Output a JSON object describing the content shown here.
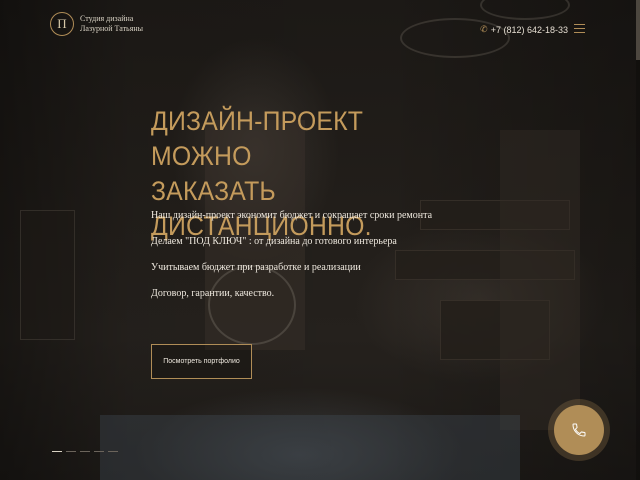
{
  "header": {
    "logo_mark": "П",
    "logo_line1": "Студия дизайна",
    "logo_line2": "Лазурной Татьяны",
    "phone": "+7 (812) 642-18-33",
    "phone_icon": "phone-icon",
    "menu_icon": "hamburger-menu-icon"
  },
  "hero": {
    "title_line1": "ДИЗАЙН-ПРОЕКТ МОЖНО",
    "title_line2": "ЗАКАЗАТЬ ДИСТАНЦИОННО.",
    "points": [
      "Наш дизайн-проект экономит бюджет и сокращает сроки ремонта",
      "Делаем \"ПОД КЛЮЧ\" : от дизайна до готового интерьера",
      "Учитываем бюджет при разработке и реализации",
      "Договор, гарантии, качество."
    ],
    "cta_label": "Посмотреть портфолио"
  },
  "slider": {
    "count": 5,
    "active_index": 0
  },
  "call_button": {
    "icon": "phone-call-icon"
  },
  "colors": {
    "accent": "#b08d57",
    "title": "#c49b5c",
    "background": "#1a1714",
    "text": "#efe9df"
  }
}
